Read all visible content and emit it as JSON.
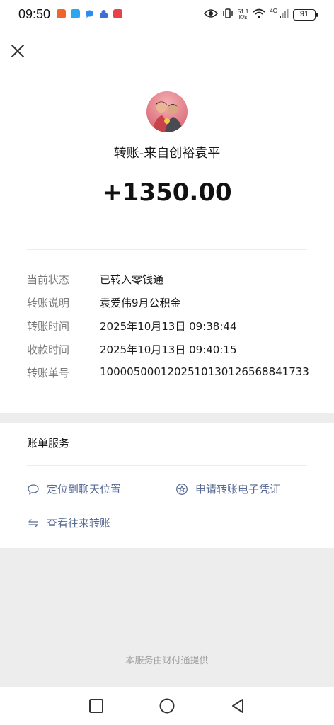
{
  "status_bar": {
    "time": "09:50",
    "net_speed_value": "51.1",
    "net_speed_unit": "K/s",
    "network": "4G",
    "battery": "91"
  },
  "transfer": {
    "title": "转账-来自创裕袁平",
    "amount": "+1350.00"
  },
  "details": [
    {
      "label": "当前状态",
      "value": "已转入零钱通"
    },
    {
      "label": "转账说明",
      "value": "袁爱伟9月公积金"
    },
    {
      "label": "转账时间",
      "value": "2025年10月13日 09:38:44"
    },
    {
      "label": "收款时间",
      "value": "2025年10月13日 09:40:15"
    },
    {
      "label": "转账单号",
      "value": "1000050001202510130126568841733"
    }
  ],
  "services": {
    "title": "账单服务",
    "locate_chat": "定位到聊天位置",
    "apply_voucher": "申请转账电子凭证",
    "view_transfers": "查看往来转账"
  },
  "footer": {
    "note": "本服务由财付通提供"
  },
  "colors": {
    "link": "#576b95",
    "background": "#ededed",
    "card": "#ffffff"
  }
}
